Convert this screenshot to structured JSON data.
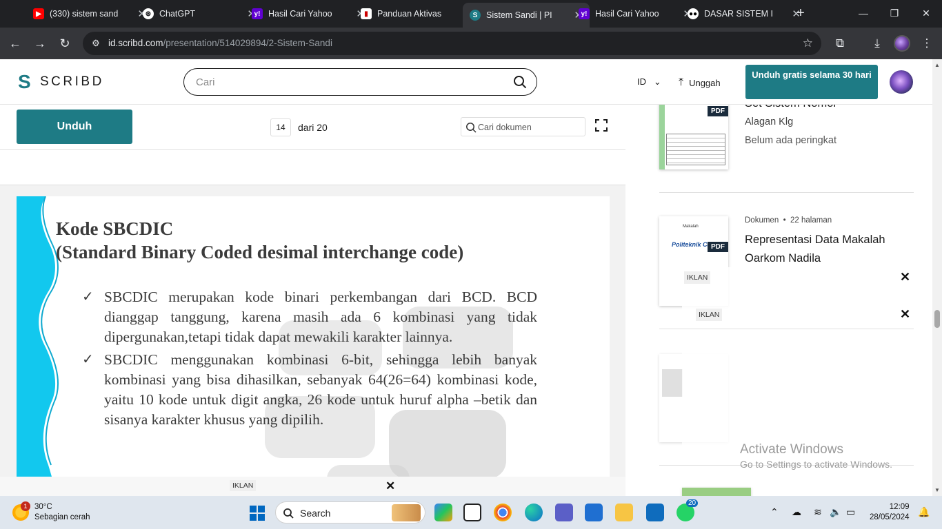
{
  "browser": {
    "tabs": [
      {
        "title": "(330) sistem sand",
        "icon": "youtube-icon"
      },
      {
        "title": "ChatGPT",
        "icon": "chatgpt-icon"
      },
      {
        "title": "Hasil Cari Yahoo",
        "icon": "yahoo-icon"
      },
      {
        "title": "Panduan Aktivas",
        "icon": "doc-icon"
      },
      {
        "title": "Sistem Sandi | PI",
        "icon": "scribd-icon"
      },
      {
        "title": "Hasil Cari Yahoo",
        "icon": "yahoo-icon"
      },
      {
        "title": "DASAR SISTEM I",
        "icon": "medium-icon"
      }
    ],
    "url_domain": "id.scribd.com",
    "url_path": "/presentation/514029894/2-Sistem-Sandi"
  },
  "header": {
    "logo": "SCRIBD",
    "search_placeholder": "Cari",
    "lang": "ID",
    "upload": "Unggah",
    "cta": "Unduh gratis selama 30 hari"
  },
  "doc_toolbar": {
    "download": "Unduh",
    "page": "14",
    "page_of": "dari 20",
    "search_placeholder": "Cari dokumen"
  },
  "slide": {
    "title_line1": "Kode SBCDIC",
    "title_line2": "(Standard Binary Coded desimal interchange code)",
    "bullets": [
      "SBCDIC merupakan kode binari perkembangan dari BCD. BCD dianggap tanggung, karena masih ada 6 kombinasi yang tidak dipergunakan,tetapi tidak dapat mewakili karakter lainnya.",
      "SBCDIC menggunakan kombinasi 6-bit, sehingga lebih banyak kombinasi yang bisa dihasilkan, sebanyak 64(26=64) kombinasi kode, yaitu 10 kode  untuk digit angka, 26 kode untuk huruf alpha –betik dan sisanya karakter khusus yang dipilih."
    ]
  },
  "ads": {
    "label": "IKLAN"
  },
  "sidebar": {
    "items": [
      {
        "title": "Set Sistem Nomor",
        "author": "Alagan Klg",
        "rating": "Belum ada peringkat"
      },
      {
        "meta_type": "Dokumen",
        "meta_pages": "22 halaman",
        "title_line1": "Representasi Data Makalah",
        "title_line2": "Oarkom Nadila"
      }
    ],
    "pdf_label": "PDF"
  },
  "watermark": {
    "line1": "Activate Windows",
    "line2": "Go to Settings to activate Windows."
  },
  "taskbar": {
    "temp": "30°C",
    "weather": "Sebagian cerah",
    "weather_badge": "1",
    "search_label": "Search",
    "whatsapp_badge": "20",
    "time": "12:09",
    "date": "28/05/2024"
  },
  "colors": {
    "brand_teal": "#1e7b85",
    "chrome_dark": "#202124",
    "slide_cyan": "#12c8ee"
  }
}
